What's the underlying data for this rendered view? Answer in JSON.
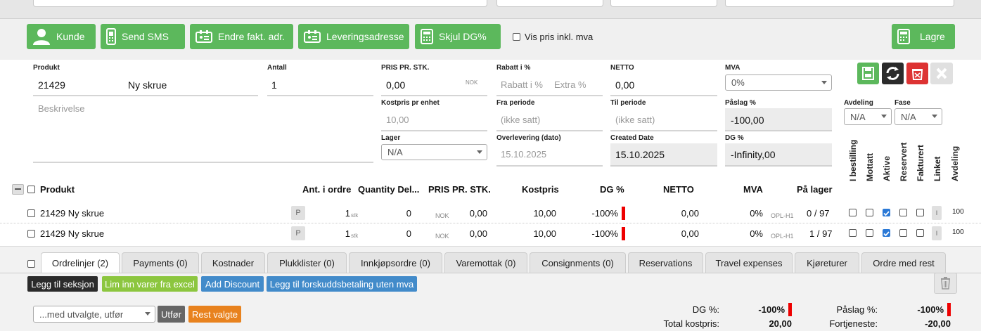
{
  "buttons": {
    "kunde": "Kunde",
    "send_sms": "Send SMS",
    "endre_fakt": "Endre fakt. adr.",
    "leveringsadresse": "Leveringsadresse",
    "skjul_dg": "Skjul DG%",
    "vis_pris": "Vis pris inkl. mva",
    "lagre": "Lagre"
  },
  "form": {
    "produkt_label": "Produkt",
    "produkt_nr": "21429",
    "produkt_navn": "Ny skrue",
    "beskrivelse_placeholder": "Beskrivelse",
    "antall_label": "Antall",
    "antall": "1",
    "pris_label": "PRIS PR. STK.",
    "pris": "0,00",
    "pris_currency": "NOK",
    "rabatt_label": "Rabatt i %",
    "rabatt_placeholder": "Rabatt i %",
    "extra_placeholder": "Extra %",
    "netto_label": "NETTO",
    "netto": "0,00",
    "mva_label": "MVA",
    "mva": "0%",
    "kostpris_label": "Kostpris pr enhet",
    "kostpris": "10,00",
    "fra_label": "Fra periode",
    "fra": "(ikke satt)",
    "til_label": "Til periode",
    "til": "(ikke satt)",
    "paslag_label": "Påslag %",
    "paslag": "-100,00",
    "lager_label": "Lager",
    "lager": "N/A",
    "overlevering_label": "Overlevering (dato)",
    "overlevering": "15.10.2025",
    "created_label": "Created Date",
    "created": "15.10.2025",
    "dg_label": "DG %",
    "dg": "-Infinity,00",
    "avdeling_label": "Avdeling",
    "avdeling": "N/A",
    "fase_label": "Fase",
    "fase": "N/A"
  },
  "table": {
    "headers": {
      "produkt": "Produkt",
      "ant": "Ant. i ordre",
      "qty_del": "Quantity Del...",
      "pris": "PRIS PR. STK.",
      "kostpris": "Kostpris",
      "dg": "DG %",
      "netto": "NETTO",
      "mva": "MVA",
      "lager": "På lager"
    },
    "vertical_headers": [
      "I bestilling",
      "Mottatt",
      "Aktive",
      "Reservert",
      "Fakturert",
      "Linket",
      "Avdeling"
    ],
    "rows": [
      {
        "produkt": "21429 Ny skrue",
        "p": "P",
        "ant": "1",
        "unit": "stk",
        "qty_del": "0",
        "currency": "NOK",
        "pris": "0,00",
        "kostpris": "10,00",
        "dg": "-100%",
        "netto": "0,00",
        "mva": "0%",
        "loc": "OPL-H1",
        "lager": "0 / 97",
        "i": "I",
        "avd": "100"
      },
      {
        "produkt": "21429 Ny skrue",
        "p": "P",
        "ant": "1",
        "unit": "stk",
        "qty_del": "0",
        "currency": "NOK",
        "pris": "0,00",
        "kostpris": "10,00",
        "dg": "-100%",
        "netto": "0,00",
        "mva": "0%",
        "loc": "OPL-H1",
        "lager": "1 / 97",
        "i": "I",
        "avd": "100"
      }
    ]
  },
  "tabs": [
    "Ordrelinjer (2)",
    "Payments (0)",
    "Kostnader",
    "Plukklister (0)",
    "Innkjøpsordre (0)",
    "Varemottak (0)",
    "Consignments (0)",
    "Reservations",
    "Travel expenses",
    "Kjøreturer",
    "Ordre med rest"
  ],
  "actions": {
    "legg_til_seksjon": "Legg til seksjon",
    "lim_inn": "Lim inn varer fra excel",
    "add_discount": "Add Discount",
    "forskudd": "Legg til forskuddsbetaling uten mva",
    "med_utvalgte": "...med utvalgte, utfør",
    "utfor": "Utfør",
    "rest_valgte": "Rest valgte"
  },
  "totals": {
    "dg_label": "DG %:",
    "dg": "-100%",
    "kost_label": "Total kostpris:",
    "kost": "20,00",
    "paslag_label": "Påslag %:",
    "paslag": "-100%",
    "fortjeneste_label": "Fortjeneste:",
    "fortjeneste": "-20,00"
  },
  "colors": {
    "green": "#5cb85c",
    "blue": "#428bca",
    "lime": "#8cc63f",
    "orange": "#e8821e",
    "dark": "#2b2b2b",
    "red": "#dd3333",
    "check": "#2b79d6"
  }
}
